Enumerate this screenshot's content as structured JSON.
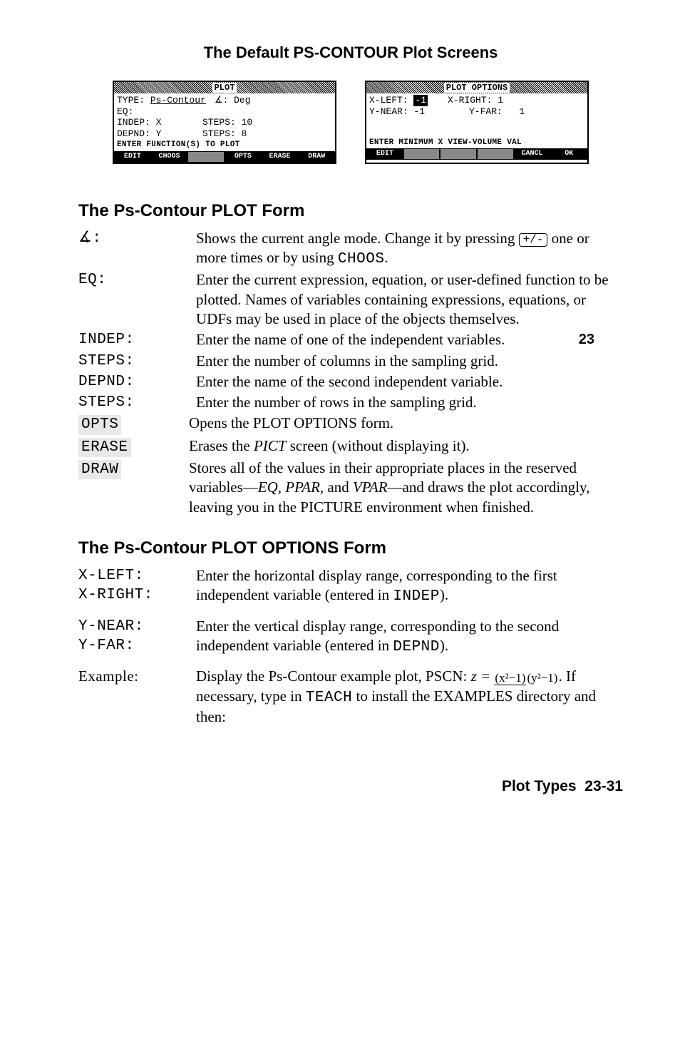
{
  "chapter_marker": "23",
  "main_title": "The Default PS-CONTOUR Plot Screens",
  "screen1": {
    "header": "PLOT",
    "line_type": "TYPE:",
    "type_val": "Ps-Contour",
    "angle": "∡: Deg",
    "eq": "EQ:",
    "indep": "INDEP: X",
    "indep_steps": "STEPS: 10",
    "depnd": "DEPND: Y",
    "depnd_steps": "STEPS: 8",
    "label": "ENTER FUNCTION(S) TO PLOT",
    "sk": [
      "EDIT",
      "CHOOS",
      "",
      "OPTS",
      "ERASE",
      "DRAW"
    ]
  },
  "screen2": {
    "header": "PLOT OPTIONS",
    "xleft": "X-LEFT:",
    "xleft_val": "-1",
    "xright": "X-RIGHT: 1",
    "ynear": "Y-NEAR: -1",
    "yfar": "Y-FAR:   1",
    "label": "ENTER MINIMUM X VIEW-VOLUME VAL",
    "sk": [
      "EDIT",
      "",
      "",
      "",
      "CANCL",
      "OK"
    ]
  },
  "section1": {
    "title": "The Ps-Contour PLOT Form",
    "rows": [
      {
        "term": "∡:",
        "desc_a": "Shows the current angle mode. Change it by pressing ",
        "key": "+/-",
        "desc_b": " one or more times or by using ",
        "mono": "CHOOS",
        "desc_c": "."
      },
      {
        "term": "EQ:",
        "desc": "Enter the current expression, equation, or user-defined function to be plotted. Names of variables containing expressions, equations, or UDFs may be used in place of the objects themselves."
      },
      {
        "term": "INDEP:",
        "desc": "Enter the name of one of the independent variables."
      },
      {
        "term": "STEPS:",
        "desc": "Enter the number of columns in the sampling grid."
      },
      {
        "term": "DEPND:",
        "desc": "Enter the name of the second independent variable."
      },
      {
        "term": "STEPS:",
        "desc": "Enter the number of rows in the sampling grid."
      },
      {
        "term": "OPTS",
        "shaded": true,
        "desc": "Opens the PLOT OPTIONS form."
      },
      {
        "term": "ERASE",
        "shaded": true,
        "desc_a": "Erases the ",
        "italic": "PICT",
        "desc_b": " screen (without displaying it)."
      },
      {
        "term": "DRAW",
        "shaded": true,
        "desc_a": "Stores all of the values in their appropriate places in the reserved variables—",
        "italic1": "EQ",
        "comma1": ", ",
        "italic2": "PPAR",
        "comma2": ", and ",
        "italic3": "VPAR",
        "desc_b": "—and draws the plot accordingly, leaving you in the PICTURE environment when finished."
      }
    ]
  },
  "section2": {
    "title": "The Ps-Contour PLOT OPTIONS Form",
    "rows": [
      {
        "term": "X-LEFT:\nX-RIGHT:",
        "desc_a": "Enter the horizontal display range, corresponding to the first independent variable (entered in ",
        "mono": "INDEP",
        "desc_b": ")."
      },
      {
        "term": "Y-NEAR:\nY-FAR:",
        "desc_a": "Enter the vertical display range, corresponding to the second independent variable (entered in ",
        "mono": "DEPND",
        "desc_b": ")."
      },
      {
        "term": "Example:",
        "example": true
      }
    ],
    "example_text": {
      "a": "Display the Ps-Contour example plot, PSCN: ",
      "z": "z = ",
      "num": "(x²−1)",
      "den": "(y²−1)",
      "b": ". If necessary, type in ",
      "mono": "TEACH",
      "c": " to install the EXAMPLES directory and then:"
    }
  },
  "footer": {
    "label": "Plot Types",
    "page": "23-31"
  }
}
